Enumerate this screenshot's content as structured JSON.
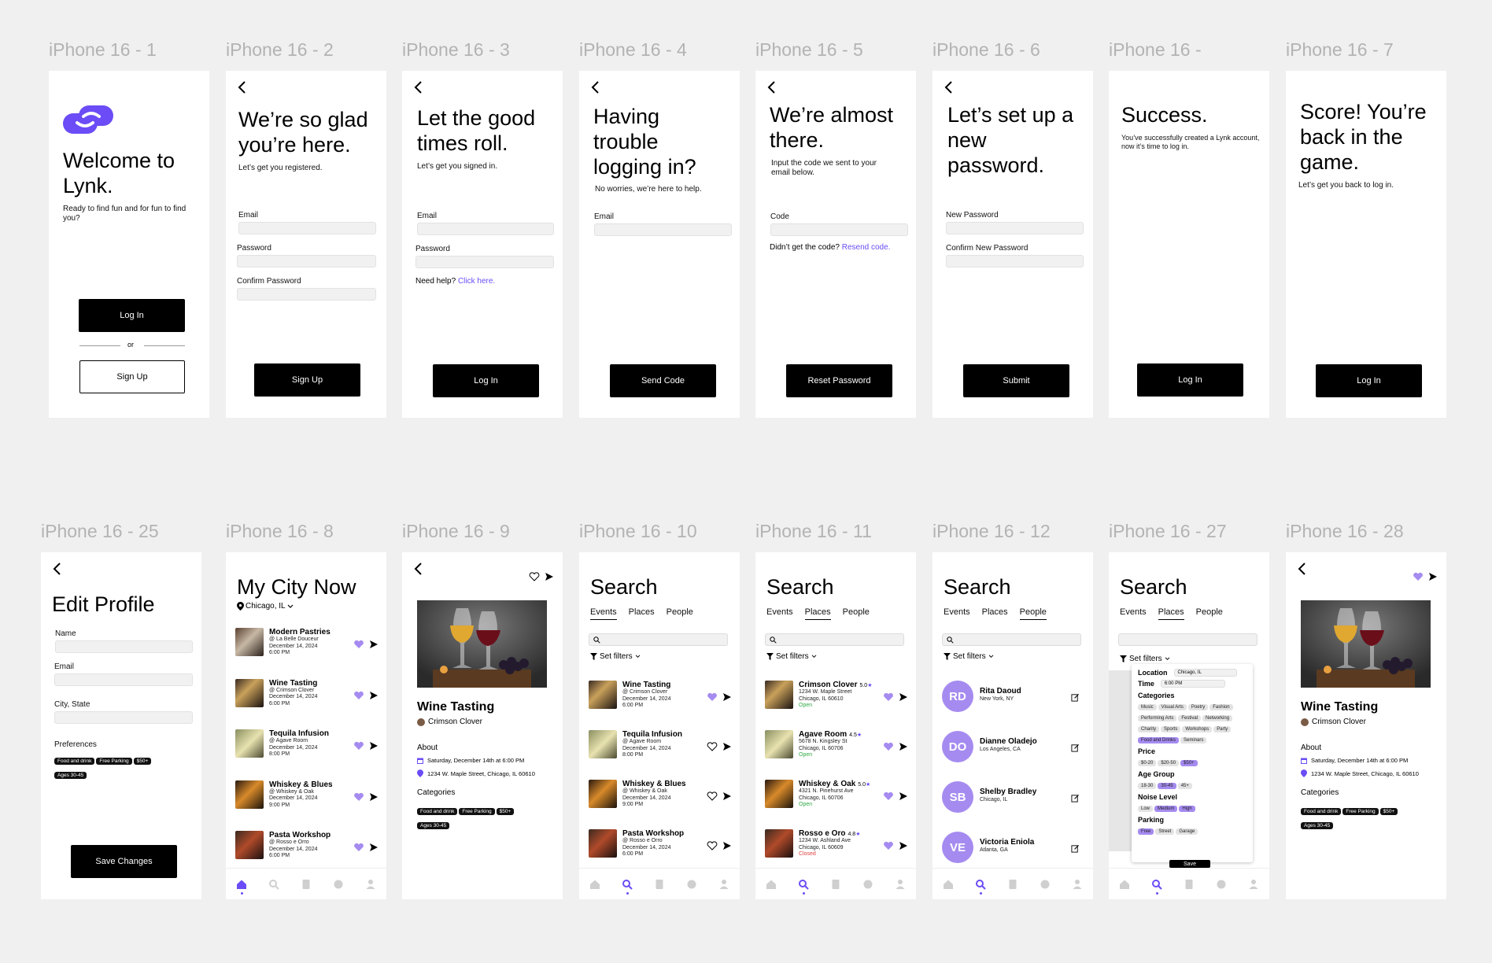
{
  "labels": [
    "iPhone 16 - 1",
    "iPhone 16 - 2",
    "iPhone 16 - 3",
    "iPhone 16 - 4",
    "iPhone 16 - 5",
    "iPhone 16 - 6",
    "iPhone 16 -",
    "iPhone 16 - 7",
    "iPhone 16 - 25",
    "iPhone 16 - 8",
    "iPhone 16 - 9",
    "iPhone 16 - 10",
    "iPhone 16 - 11",
    "iPhone 16 - 12",
    "iPhone 16 - 27",
    "iPhone 16 - 28"
  ],
  "colors": {
    "accent": "#6b4cf6",
    "avatar": "#a58bf0",
    "heart": "#a58bf0",
    "open": "#2eaa44",
    "closed": "#e04040",
    "canvas": "#f0f0f0"
  },
  "s1": {
    "title": "Welcome to Lynk.",
    "sub": "Ready to find fun and for fun to find you?",
    "login": "Log In",
    "or": "or",
    "signup": "Sign Up"
  },
  "s2": {
    "title": "We’re so glad you’re here.",
    "sub": "Let’s get you registered.",
    "email": "Email",
    "password": "Password",
    "confirm": "Confirm Password",
    "btn": "Sign Up"
  },
  "s3": {
    "title": "Let the good times roll.",
    "sub": "Let’s get you signed in.",
    "email": "Email",
    "password": "Password",
    "help": "Need help?",
    "help_link": "Click here.",
    "btn": "Log In"
  },
  "s4": {
    "title": "Having trouble logging in?",
    "sub": "No worries, we’re here to help.",
    "email": "Email",
    "btn": "Send Code"
  },
  "s5": {
    "title": "We’re almost there.",
    "sub": "Input the code we sent to your email below.",
    "code": "Code",
    "q": "Didn’t get the code?",
    "link": "Resend code.",
    "btn": "Reset Password"
  },
  "s6": {
    "title": "Let’s set up a new password.",
    "new": "New Password",
    "confirm": "Confirm New Password",
    "btn": "Submit"
  },
  "s7": {
    "title": "Success.",
    "sub": "You’ve successfully created a Lynk account, now it’s time to log in.",
    "btn": "Log In"
  },
  "s8": {
    "title": "Score! You’re back in the game.",
    "sub": "Let’s get you back to log in.",
    "btn": "Log In"
  },
  "edit": {
    "title": "Edit Profile",
    "name": "Name",
    "email": "Email",
    "city": "City, State",
    "prefs": "Preferences",
    "tags": [
      "Food and drink",
      "Free Parking",
      "$50+",
      "Ages 30-45"
    ],
    "btn": "Save Changes"
  },
  "city": {
    "title": "My City Now",
    "location": "Chicago, IL"
  },
  "events": [
    {
      "title": "Modern Pastries",
      "venue": "@ La Belle Douceur",
      "date": "December 14, 2024",
      "time": "6:00 PM",
      "liked": true
    },
    {
      "title": "Wine Tasting",
      "venue": "@ Crimson Clover",
      "date": "December 14, 2024",
      "time": "6:00 PM",
      "liked": true
    },
    {
      "title": "Tequila Infusion",
      "venue": "@ Agave Room",
      "date": "December 14, 2024",
      "time": "8:00 PM",
      "liked": true
    },
    {
      "title": "Whiskey & Blues",
      "venue": "@ Whiskey & Oak",
      "date": "December 14, 2024",
      "time": "9:00 PM",
      "liked": true
    },
    {
      "title": "Pasta Workshop",
      "venue": "@ Rosso e Orro",
      "date": "December 14, 2024",
      "time": "6:00 PM",
      "liked": true
    }
  ],
  "search_events": [
    {
      "title": "Wine Tasting",
      "venue": "@ Crimson Clover",
      "date": "December 14, 2024",
      "time": "6:00 PM",
      "liked": true
    },
    {
      "title": "Tequila Infusion",
      "venue": "@ Agave Room",
      "date": "December 14, 2024",
      "time": "8:00 PM",
      "liked": false
    },
    {
      "title": "Whiskey & Blues",
      "venue": "@ Whiskey & Oak",
      "date": "December 14, 2024",
      "time": "9:00 PM",
      "liked": false
    },
    {
      "title": "Pasta Workshop",
      "venue": "@ Rosso e Orro",
      "date": "December 14, 2024",
      "time": "6:00 PM",
      "liked": false
    }
  ],
  "detail": {
    "title": "Wine Tasting",
    "venue": "Crimson Clover",
    "about": "About",
    "date": "Saturday, December 14th at 6:00 PM",
    "address": "1234 W. Maple Street, Chicago, IL 60610",
    "categories": "Categories",
    "tags": [
      "Food and drink",
      "Free Parking",
      "$50+",
      "Ages 30-45"
    ]
  },
  "search": {
    "title": "Search",
    "tabs": [
      "Events",
      "Places",
      "People"
    ],
    "filters": "Set filters"
  },
  "places": [
    {
      "name": "Crimson Clover",
      "rating": "5.0",
      "addr1": "1234 W. Maple Street",
      "addr2": "Chicago, IL 60610",
      "status": "Open",
      "open": true
    },
    {
      "name": "Agave Room",
      "rating": "4.5",
      "addr1": "5678 N. Kingsley St",
      "addr2": "Chicago, IL 60706",
      "status": "Open",
      "open": true
    },
    {
      "name": "Whiskey & Oak",
      "rating": "5.0",
      "addr1": "4321 N. Pinehurst Ave",
      "addr2": "Chicago, IL 60706",
      "status": "Open",
      "open": true
    },
    {
      "name": "Rosso e Oro",
      "rating": "4.8",
      "addr1": "1234 W. Ashland Ave",
      "addr2": "Chicago, IL 60609",
      "status": "Closed",
      "open": false
    }
  ],
  "people": [
    {
      "initials": "RD",
      "name": "Rita Daoud",
      "loc": "New York, NY"
    },
    {
      "initials": "DO",
      "name": "Dianne Oladejo",
      "loc": "Los Angeles, CA"
    },
    {
      "initials": "SB",
      "name": "Shelby Bradley",
      "loc": "Chicago, IL"
    },
    {
      "initials": "VE",
      "name": "Victoria Eniola",
      "loc": "Atlanta, GA"
    }
  ],
  "filters": {
    "location_label": "Location",
    "location": "Chicago, IL",
    "time_label": "Time",
    "time": "6:00 PM",
    "categories_label": "Categories",
    "categories": [
      {
        "t": "Music",
        "on": false
      },
      {
        "t": "Visual Arts",
        "on": false
      },
      {
        "t": "Poetry",
        "on": false
      },
      {
        "t": "Fashion",
        "on": false
      },
      {
        "t": "Performing Arts",
        "on": false
      },
      {
        "t": "Festival",
        "on": false
      },
      {
        "t": "Networking",
        "on": false
      },
      {
        "t": "Charity",
        "on": false
      },
      {
        "t": "Sports",
        "on": false
      },
      {
        "t": "Workshops",
        "on": false
      },
      {
        "t": "Party",
        "on": false
      },
      {
        "t": "Food and Drinks",
        "on": true
      },
      {
        "t": "Seminars",
        "on": false
      }
    ],
    "price_label": "Price",
    "price": [
      {
        "t": "$0-20",
        "on": false
      },
      {
        "t": "$20-50",
        "on": false
      },
      {
        "t": "$50+",
        "on": true
      }
    ],
    "age_label": "Age Group",
    "age": [
      {
        "t": "18-30",
        "on": false
      },
      {
        "t": "30-45",
        "on": true
      },
      {
        "t": "45+",
        "on": false
      }
    ],
    "noise_label": "Noise Level",
    "noise": [
      {
        "t": "Low",
        "on": false
      },
      {
        "t": "Medium",
        "on": true
      },
      {
        "t": "High",
        "on": true
      }
    ],
    "parking_label": "Parking",
    "parking": [
      {
        "t": "Free",
        "on": true
      },
      {
        "t": "Street",
        "on": false
      },
      {
        "t": "Garage",
        "on": false
      }
    ],
    "save": "Save"
  }
}
